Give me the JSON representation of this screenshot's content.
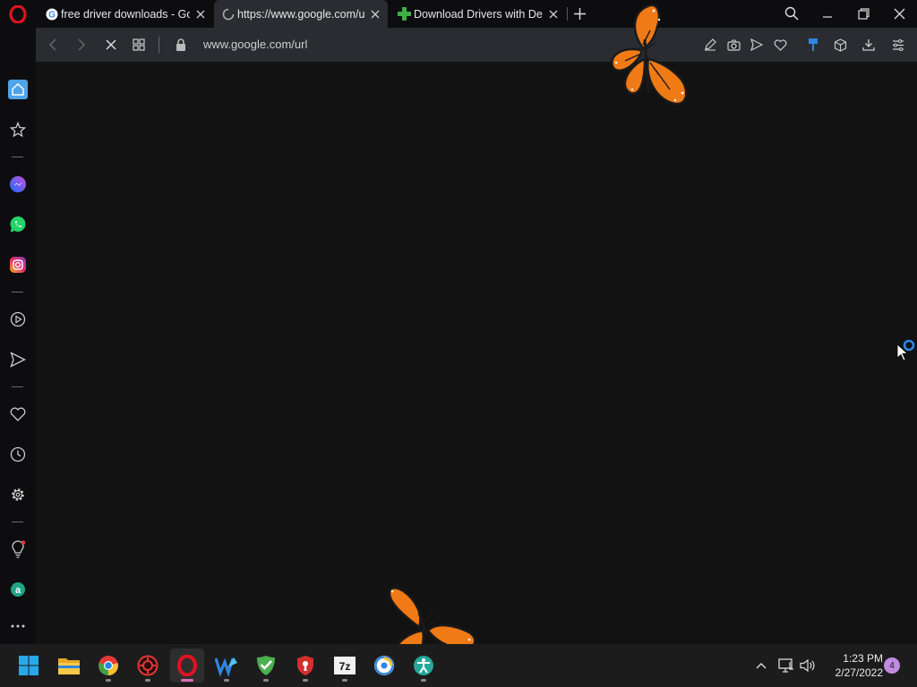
{
  "browser": {
    "tabs": [
      {
        "title": "free driver downloads - Google Search",
        "icon": "google-icon"
      },
      {
        "title": "https://www.google.com/url?q=",
        "icon": "loading-spinner-icon"
      },
      {
        "title": "Download Drivers with Device Doctor",
        "icon": "device-doctor-icon"
      }
    ],
    "address": "www.google.com/url"
  },
  "taskbar": {
    "apps": [
      "windows-start",
      "file-explorer",
      "chrome",
      "gaming-app",
      "opera",
      "waterfox",
      "adguard",
      "security-shield",
      "7-zip",
      "browser-app",
      "accessibility-app"
    ],
    "clock": {
      "time": "1:23 PM",
      "date": "2/27/2022"
    },
    "notification_count": "4"
  },
  "colors": {
    "accent": "#4fa3e8",
    "opera_red": "#e0131f",
    "butterfly": "#f07a15"
  }
}
